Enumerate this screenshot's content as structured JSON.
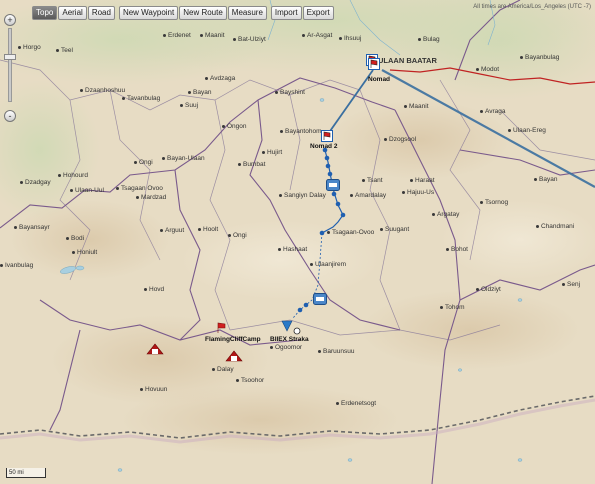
{
  "toolbar": {
    "map_type_buttons": [
      "Topo",
      "Aerial",
      "Road"
    ],
    "active_map_type": "Topo",
    "edit_buttons": [
      "New Waypoint",
      "New Route",
      "Measure"
    ],
    "file_buttons": [
      "Import",
      "Export"
    ]
  },
  "attribution": "All times are America/Los_Angeles (UTC -7)",
  "zoom": {
    "in": "+",
    "out": "-",
    "level_fraction": 0.62
  },
  "scale_label": "50 mi",
  "capital": "ULAAN BAATAR",
  "places": [
    "Horgo",
    "Teel",
    "Erdenet",
    "Maanit",
    "Bat-Ulziyt",
    "Ar-Asgat",
    "Ihsuuj",
    "Bulag",
    "Bayanbulag",
    "Dzaanhoshuu",
    "Tavanbulag",
    "Bayan",
    "Bayshint",
    "Modot",
    "Avdzaga",
    "Suuj",
    "Maanit",
    "Avraga",
    "Ongon",
    "Ulaan-Ereg",
    "Bayantohom",
    "Dzogsool",
    "Hujirt",
    "Ongi",
    "Bayan-Ulaan",
    "Bumbat",
    "Dzadgay",
    "Hohourd",
    "Ulaan-Uul",
    "Tsagaan Ovoo",
    "Mardzad",
    "Tsant",
    "Haraat",
    "Bayan",
    "Sangiyn Dalay",
    "Amardalay",
    "Hajuu-Us",
    "Tsornog",
    "Bayansayr",
    "Arguut",
    "Hoolt",
    "Argatay",
    "Chandmani",
    "Bodi",
    "Ongi",
    "Tsagaan-Ovoo",
    "Suugant",
    "Honiult",
    "Hashaat",
    "Bohot",
    "Ivanbulag",
    "Ulaanjirem",
    "Hovd",
    "Oldziyt",
    "Senj",
    "Tohom",
    "Ogoomor",
    "Dalay",
    "Baruunsuu",
    "Tsoohor",
    "Hovuun",
    "Erdenetsogt"
  ],
  "waypoints": [
    "Nomad",
    "Nomad 2",
    "FlamingCliffCamp",
    "BIIEX Straka"
  ],
  "colors": {
    "route": "#1f5fb0",
    "route_dot": "#1f5fb0",
    "border_primary": "#7a5a8c",
    "road_red": "#c02222",
    "sand": "#e7dcc4",
    "flag": "#d01f1f",
    "camp_icon": "#b01818",
    "triangle": "#2a7ac8"
  }
}
